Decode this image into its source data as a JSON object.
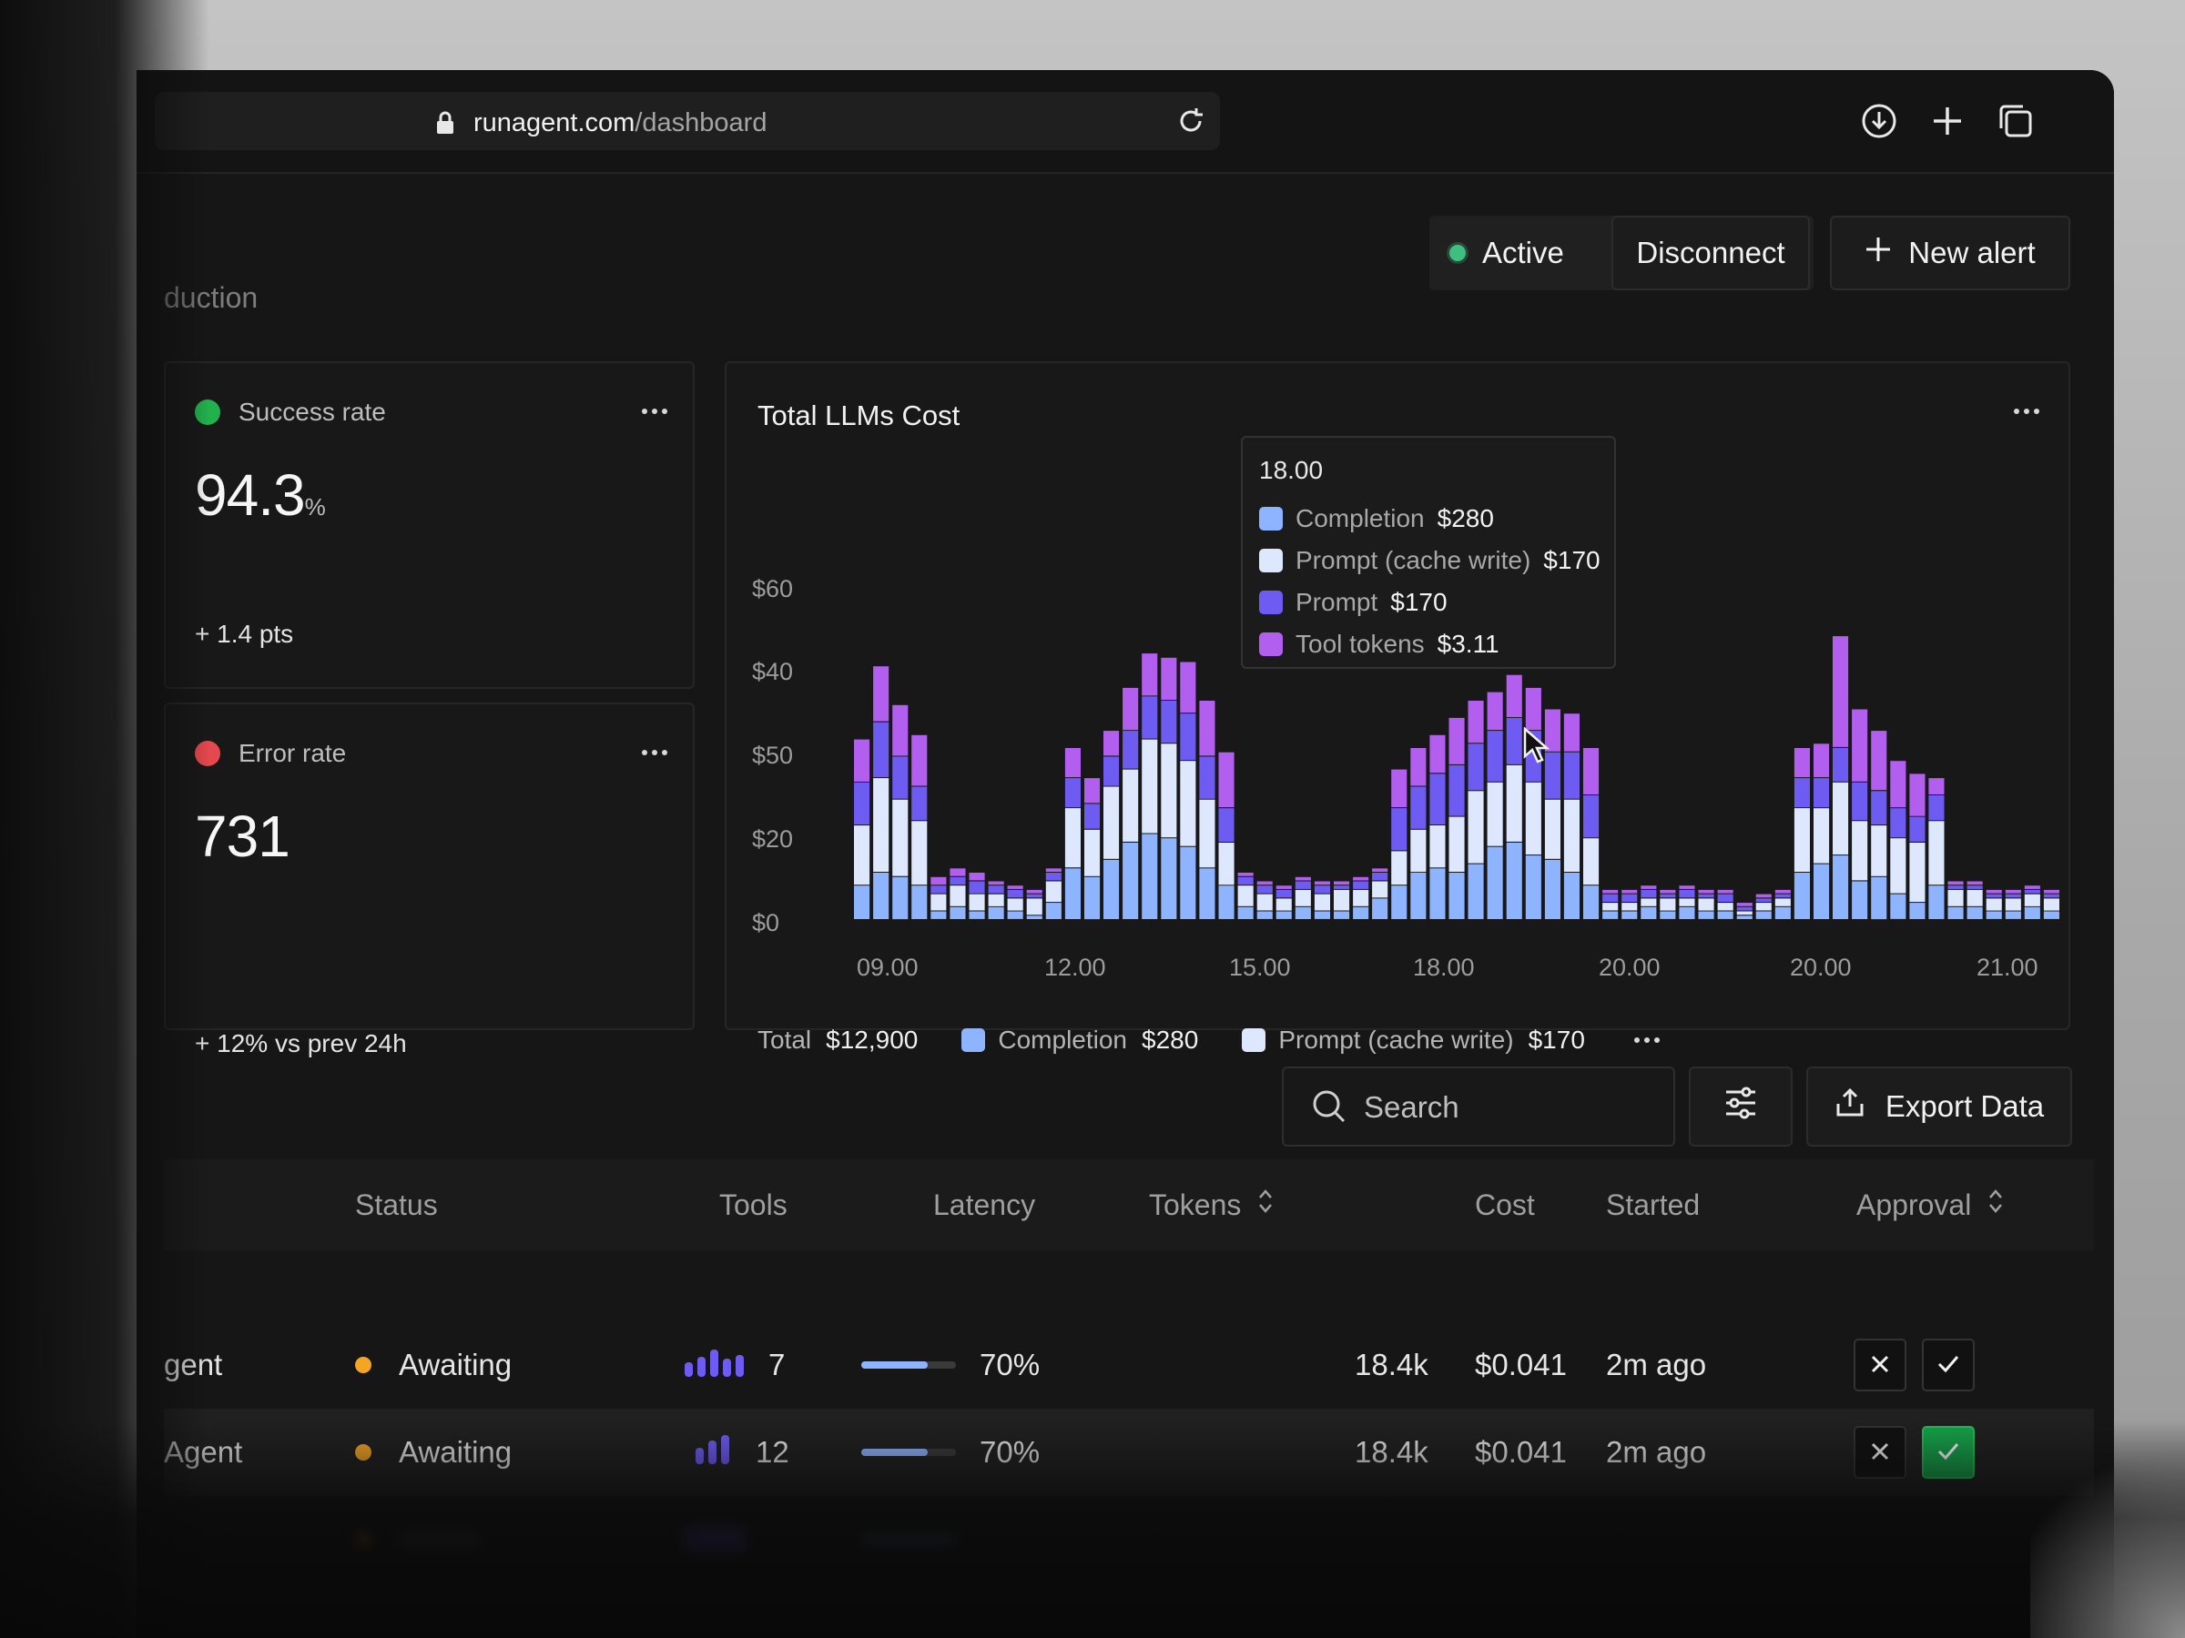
{
  "browser": {
    "url_domain": "runagent.com",
    "url_path": "/dashboard",
    "icons": [
      "lock-icon",
      "reload-icon",
      "download-icon",
      "new-tab-icon",
      "tabs-icon"
    ]
  },
  "header": {
    "subtitle": "duction",
    "status_label": "Active",
    "status_color": "#3fbf7f",
    "disconnect_label": "Disconnect",
    "new_alert_label": "New alert"
  },
  "kpis": [
    {
      "label": "Success rate",
      "value": "94.3",
      "unit": "%",
      "footnote": "+ 1.4 pts",
      "dot_color": "#22b14c"
    },
    {
      "label": "Error rate",
      "value": "731",
      "unit": "",
      "footnote": "+ 12% vs prev 24h",
      "dot_color": "#e5484d"
    }
  ],
  "chart": {
    "title": "Total LLMs Cost",
    "tooltip": {
      "time": "18.00",
      "rows": [
        {
          "name": "Completion",
          "value": "$280",
          "color": "#8fb4ff"
        },
        {
          "name": "Prompt (cache write)",
          "value": "$170",
          "color": "#dde8ff"
        },
        {
          "name": "Prompt",
          "value": "$170",
          "color": "#6e5cf2"
        },
        {
          "name": "Tool tokens",
          "value": "$3.11",
          "color": "#b25ff0"
        }
      ]
    },
    "footer": {
      "total_label": "Total",
      "total_value": "$12,900",
      "items": [
        {
          "name": "Completion",
          "value": "$280"
        },
        {
          "name": "Prompt (cache write)",
          "value": "$170"
        }
      ]
    }
  },
  "chart_data": {
    "type": "bar",
    "title": "Total LLMs Cost",
    "y_tick_labels": [
      "$60",
      "$40",
      "$50",
      "$20",
      "$0"
    ],
    "x_tick_labels": [
      "09.00",
      "12.00",
      "15.00",
      "18.00",
      "20.00",
      "20.00",
      "21.00"
    ],
    "ylim": [
      0,
      80
    ],
    "stacked": true,
    "series": [
      {
        "name": "Completion",
        "color": "#8fb4ff",
        "values": [
          8,
          11,
          10,
          8,
          2,
          3,
          2,
          3,
          2,
          1,
          4,
          12,
          10,
          14,
          18,
          20,
          19,
          17,
          12,
          8,
          3,
          2,
          2,
          3,
          2,
          2,
          3,
          5,
          8,
          11,
          12,
          11,
          13,
          17,
          18,
          15,
          14,
          11,
          8,
          2,
          2,
          3,
          2,
          3,
          2,
          2,
          1,
          2,
          3,
          11,
          13,
          15,
          9,
          10,
          6,
          4,
          8,
          3,
          3,
          2,
          2,
          3,
          2
        ]
      },
      {
        "name": "Prompt (cache write)",
        "value": "$170",
        "color": "#dde8ff",
        "values": [
          14,
          22,
          18,
          15,
          4,
          5,
          4,
          3,
          3,
          4,
          5,
          14,
          11,
          17,
          17,
          22,
          22,
          20,
          16,
          10,
          5,
          4,
          3,
          4,
          4,
          5,
          4,
          4,
          8,
          10,
          10,
          13,
          17,
          15,
          18,
          17,
          14,
          17,
          11,
          2,
          2,
          2,
          3,
          2,
          3,
          2,
          1,
          2,
          2,
          15,
          13,
          17,
          14,
          12,
          13,
          14,
          15,
          4,
          4,
          3,
          3,
          3,
          3
        ]
      },
      {
        "name": "Prompt",
        "color": "#6e5cf2",
        "values": [
          10,
          13,
          10,
          8,
          2,
          2,
          3,
          2,
          2,
          1,
          2,
          7,
          6,
          7,
          9,
          10,
          10,
          11,
          10,
          8,
          2,
          2,
          2,
          2,
          2,
          1,
          2,
          2,
          10,
          10,
          12,
          12,
          11,
          12,
          11,
          12,
          11,
          11,
          10,
          2,
          2,
          2,
          1,
          2,
          1,
          2,
          1,
          1,
          1,
          7,
          7,
          8,
          9,
          8,
          7,
          6,
          6,
          1,
          1,
          1,
          1,
          1,
          1
        ]
      },
      {
        "name": "Tool tokens",
        "color": "#b25ff0",
        "values": [
          10,
          13,
          12,
          12,
          2,
          2,
          2,
          1,
          1,
          1,
          1,
          7,
          6,
          6,
          10,
          10,
          10,
          12,
          13,
          13,
          1,
          1,
          1,
          1,
          1,
          1,
          1,
          1,
          9,
          9,
          9,
          11,
          10,
          9,
          10,
          10,
          10,
          9,
          11,
          1,
          1,
          1,
          1,
          1,
          1,
          1,
          1,
          1,
          1,
          7,
          8,
          26,
          17,
          14,
          11,
          10,
          4,
          1,
          1,
          1,
          1,
          1,
          1
        ]
      }
    ]
  },
  "toolbar": {
    "search_placeholder": "Search",
    "export_label": "Export Data"
  },
  "table": {
    "columns": [
      "Status",
      "Tools",
      "Latency",
      "Tokens",
      "Cost",
      "Started",
      "Approval"
    ],
    "rows": [
      {
        "agent": "gent",
        "status": "Awaiting",
        "status_color": "#f5a524",
        "tools": "7",
        "latency": "70%",
        "latency_level": 0.7,
        "tokens": "18.4k",
        "cost": "$0.041",
        "started": "2m ago",
        "approved": false
      },
      {
        "agent": "Agent",
        "status": "Awaiting",
        "status_color": "#f5a524",
        "tools": "12",
        "latency": "70%",
        "latency_level": 0.7,
        "tokens": "18.4k",
        "cost": "$0.041",
        "started": "2m ago",
        "approved": true
      }
    ]
  }
}
